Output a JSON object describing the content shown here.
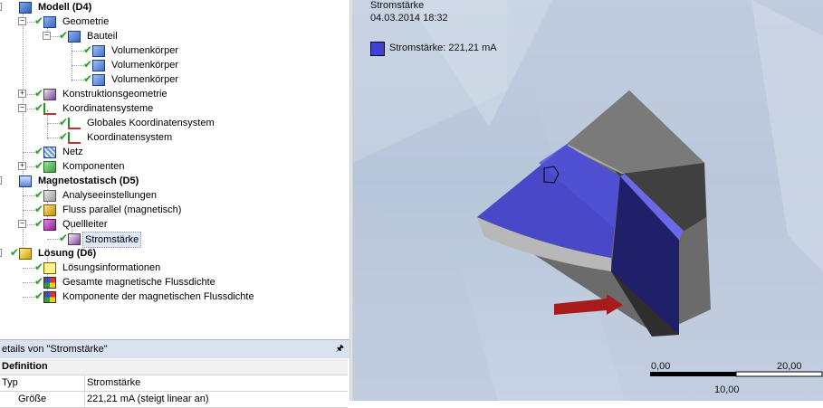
{
  "tree": {
    "items": [
      {
        "label": "Modell (D4)",
        "bold": true,
        "toggle": "-",
        "icon": "model-icon"
      },
      {
        "label": "Geometrie",
        "bold": false,
        "toggle": "-",
        "icon": "geometry-icon"
      },
      {
        "label": "Bauteil",
        "bold": false,
        "toggle": "-",
        "icon": "part-icon"
      },
      {
        "label": "Volumenkörper",
        "bold": false,
        "toggle": "",
        "icon": "solid-body-icon"
      },
      {
        "label": "Volumenkörper",
        "bold": false,
        "toggle": "",
        "icon": "solid-body-icon"
      },
      {
        "label": "Volumenkörper",
        "bold": false,
        "toggle": "",
        "icon": "solid-body-icon"
      },
      {
        "label": "Konstruktionsgeometrie",
        "bold": false,
        "toggle": "+",
        "icon": "construction-geometry-icon"
      },
      {
        "label": "Koordinatensysteme",
        "bold": false,
        "toggle": "-",
        "icon": "coordinate-systems-icon"
      },
      {
        "label": "Globales Koordinatensystem",
        "bold": false,
        "toggle": "",
        "icon": "coordinate-system-icon"
      },
      {
        "label": "Koordinatensystem",
        "bold": false,
        "toggle": "",
        "icon": "coordinate-system-icon"
      },
      {
        "label": "Netz",
        "bold": false,
        "toggle": "",
        "icon": "mesh-icon"
      },
      {
        "label": "Komponenten",
        "bold": false,
        "toggle": "+",
        "icon": "components-icon"
      },
      {
        "label": "Magnetostatisch (D5)",
        "bold": true,
        "toggle": "-",
        "icon": "magnetostatic-analysis-icon"
      },
      {
        "label": "Analyseeinstellungen",
        "bold": false,
        "toggle": "",
        "icon": "analysis-settings-icon"
      },
      {
        "label": "Fluss parallel (magnetisch)",
        "bold": false,
        "toggle": "",
        "icon": "flux-parallel-icon"
      },
      {
        "label": "Quellleiter",
        "bold": false,
        "toggle": "-",
        "icon": "source-conductor-icon"
      },
      {
        "label": "Stromstärke",
        "bold": false,
        "toggle": "",
        "icon": "current-icon",
        "selected": true
      },
      {
        "label": "Lösung (D6)",
        "bold": true,
        "toggle": "-",
        "icon": "solution-icon"
      },
      {
        "label": "Lösungsinformationen",
        "bold": false,
        "toggle": "",
        "icon": "solution-information-icon"
      },
      {
        "label": "Gesamte magnetische Flussdichte",
        "bold": false,
        "toggle": "",
        "icon": "result-icon"
      },
      {
        "label": "Komponente der magnetischen Flussdichte",
        "bold": false,
        "toggle": "",
        "icon": "result-icon"
      }
    ]
  },
  "details": {
    "title": "etails von \"Stromstärke\"",
    "pin_icon": "pin-icon",
    "section": "Definition",
    "rows": [
      {
        "key": "Typ",
        "value": "Stromstärke"
      },
      {
        "key": "Größe",
        "value": "221,21 mA  (steigt linear an)"
      }
    ]
  },
  "viewport": {
    "title": "Stromstärke",
    "timestamp": "04.03.2014 18:32",
    "legend": {
      "label": "Stromstärke: 221,21 mA",
      "color": "#4040d8"
    },
    "scale": {
      "tick_left": "0,00",
      "tick_right": "20,00",
      "tick_mid": "10,00"
    }
  }
}
